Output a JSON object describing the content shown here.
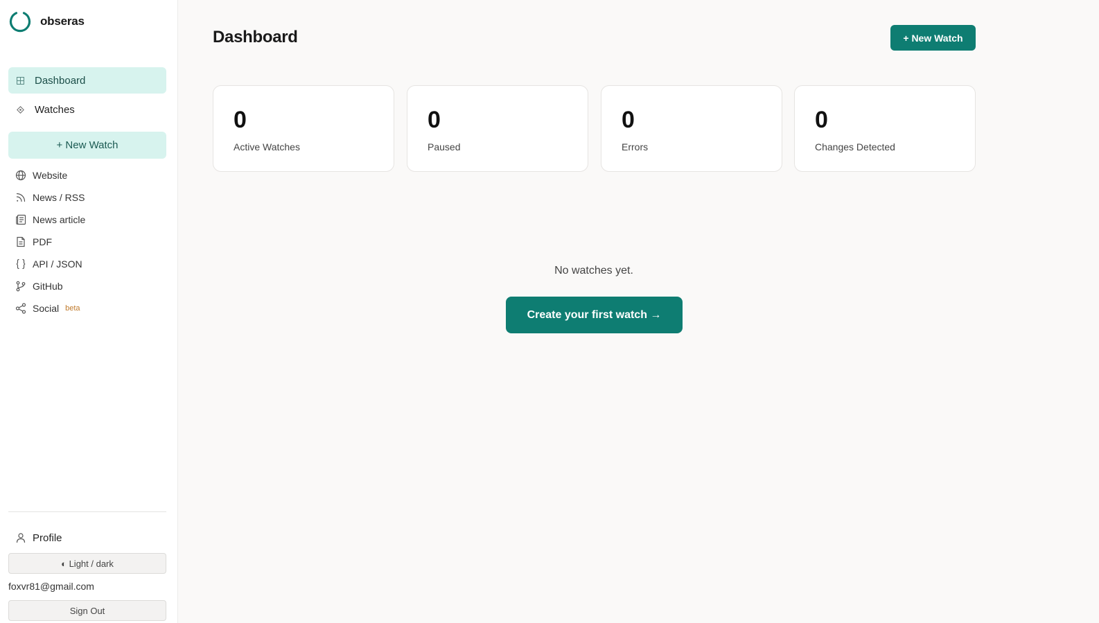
{
  "brand": {
    "name": "obseras",
    "logo_icon": "ring-logo-icon",
    "accent": "#0e7d72"
  },
  "sidebar": {
    "nav": [
      {
        "label": "Dashboard",
        "icon": "grid-icon",
        "active": true
      },
      {
        "label": "Watches",
        "icon": "diamond-icon",
        "active": false
      }
    ],
    "new_watch_label": "+ New Watch",
    "types": [
      {
        "label": "Website",
        "icon": "globe-icon"
      },
      {
        "label": "News / RSS",
        "icon": "rss-icon"
      },
      {
        "label": "News article",
        "icon": "newspaper-icon"
      },
      {
        "label": "PDF",
        "icon": "document-icon"
      },
      {
        "label": "API / JSON",
        "icon": "braces-icon"
      },
      {
        "label": "GitHub",
        "icon": "git-branch-icon"
      },
      {
        "label": "Social",
        "icon": "share-icon",
        "badge": "beta"
      }
    ],
    "profile_label": "Profile",
    "theme_label": "◐ Light / dark",
    "email": "foxvr81@gmail.com",
    "signout_label": "Sign Out"
  },
  "main": {
    "title": "Dashboard",
    "new_watch_label": "+ New Watch",
    "stats": [
      {
        "value": "0",
        "label": "Active Watches"
      },
      {
        "value": "0",
        "label": "Paused"
      },
      {
        "value": "0",
        "label": "Errors"
      },
      {
        "value": "0",
        "label": "Changes Detected"
      }
    ],
    "empty_text": "No watches yet.",
    "create_label": "Create your first watch →"
  }
}
